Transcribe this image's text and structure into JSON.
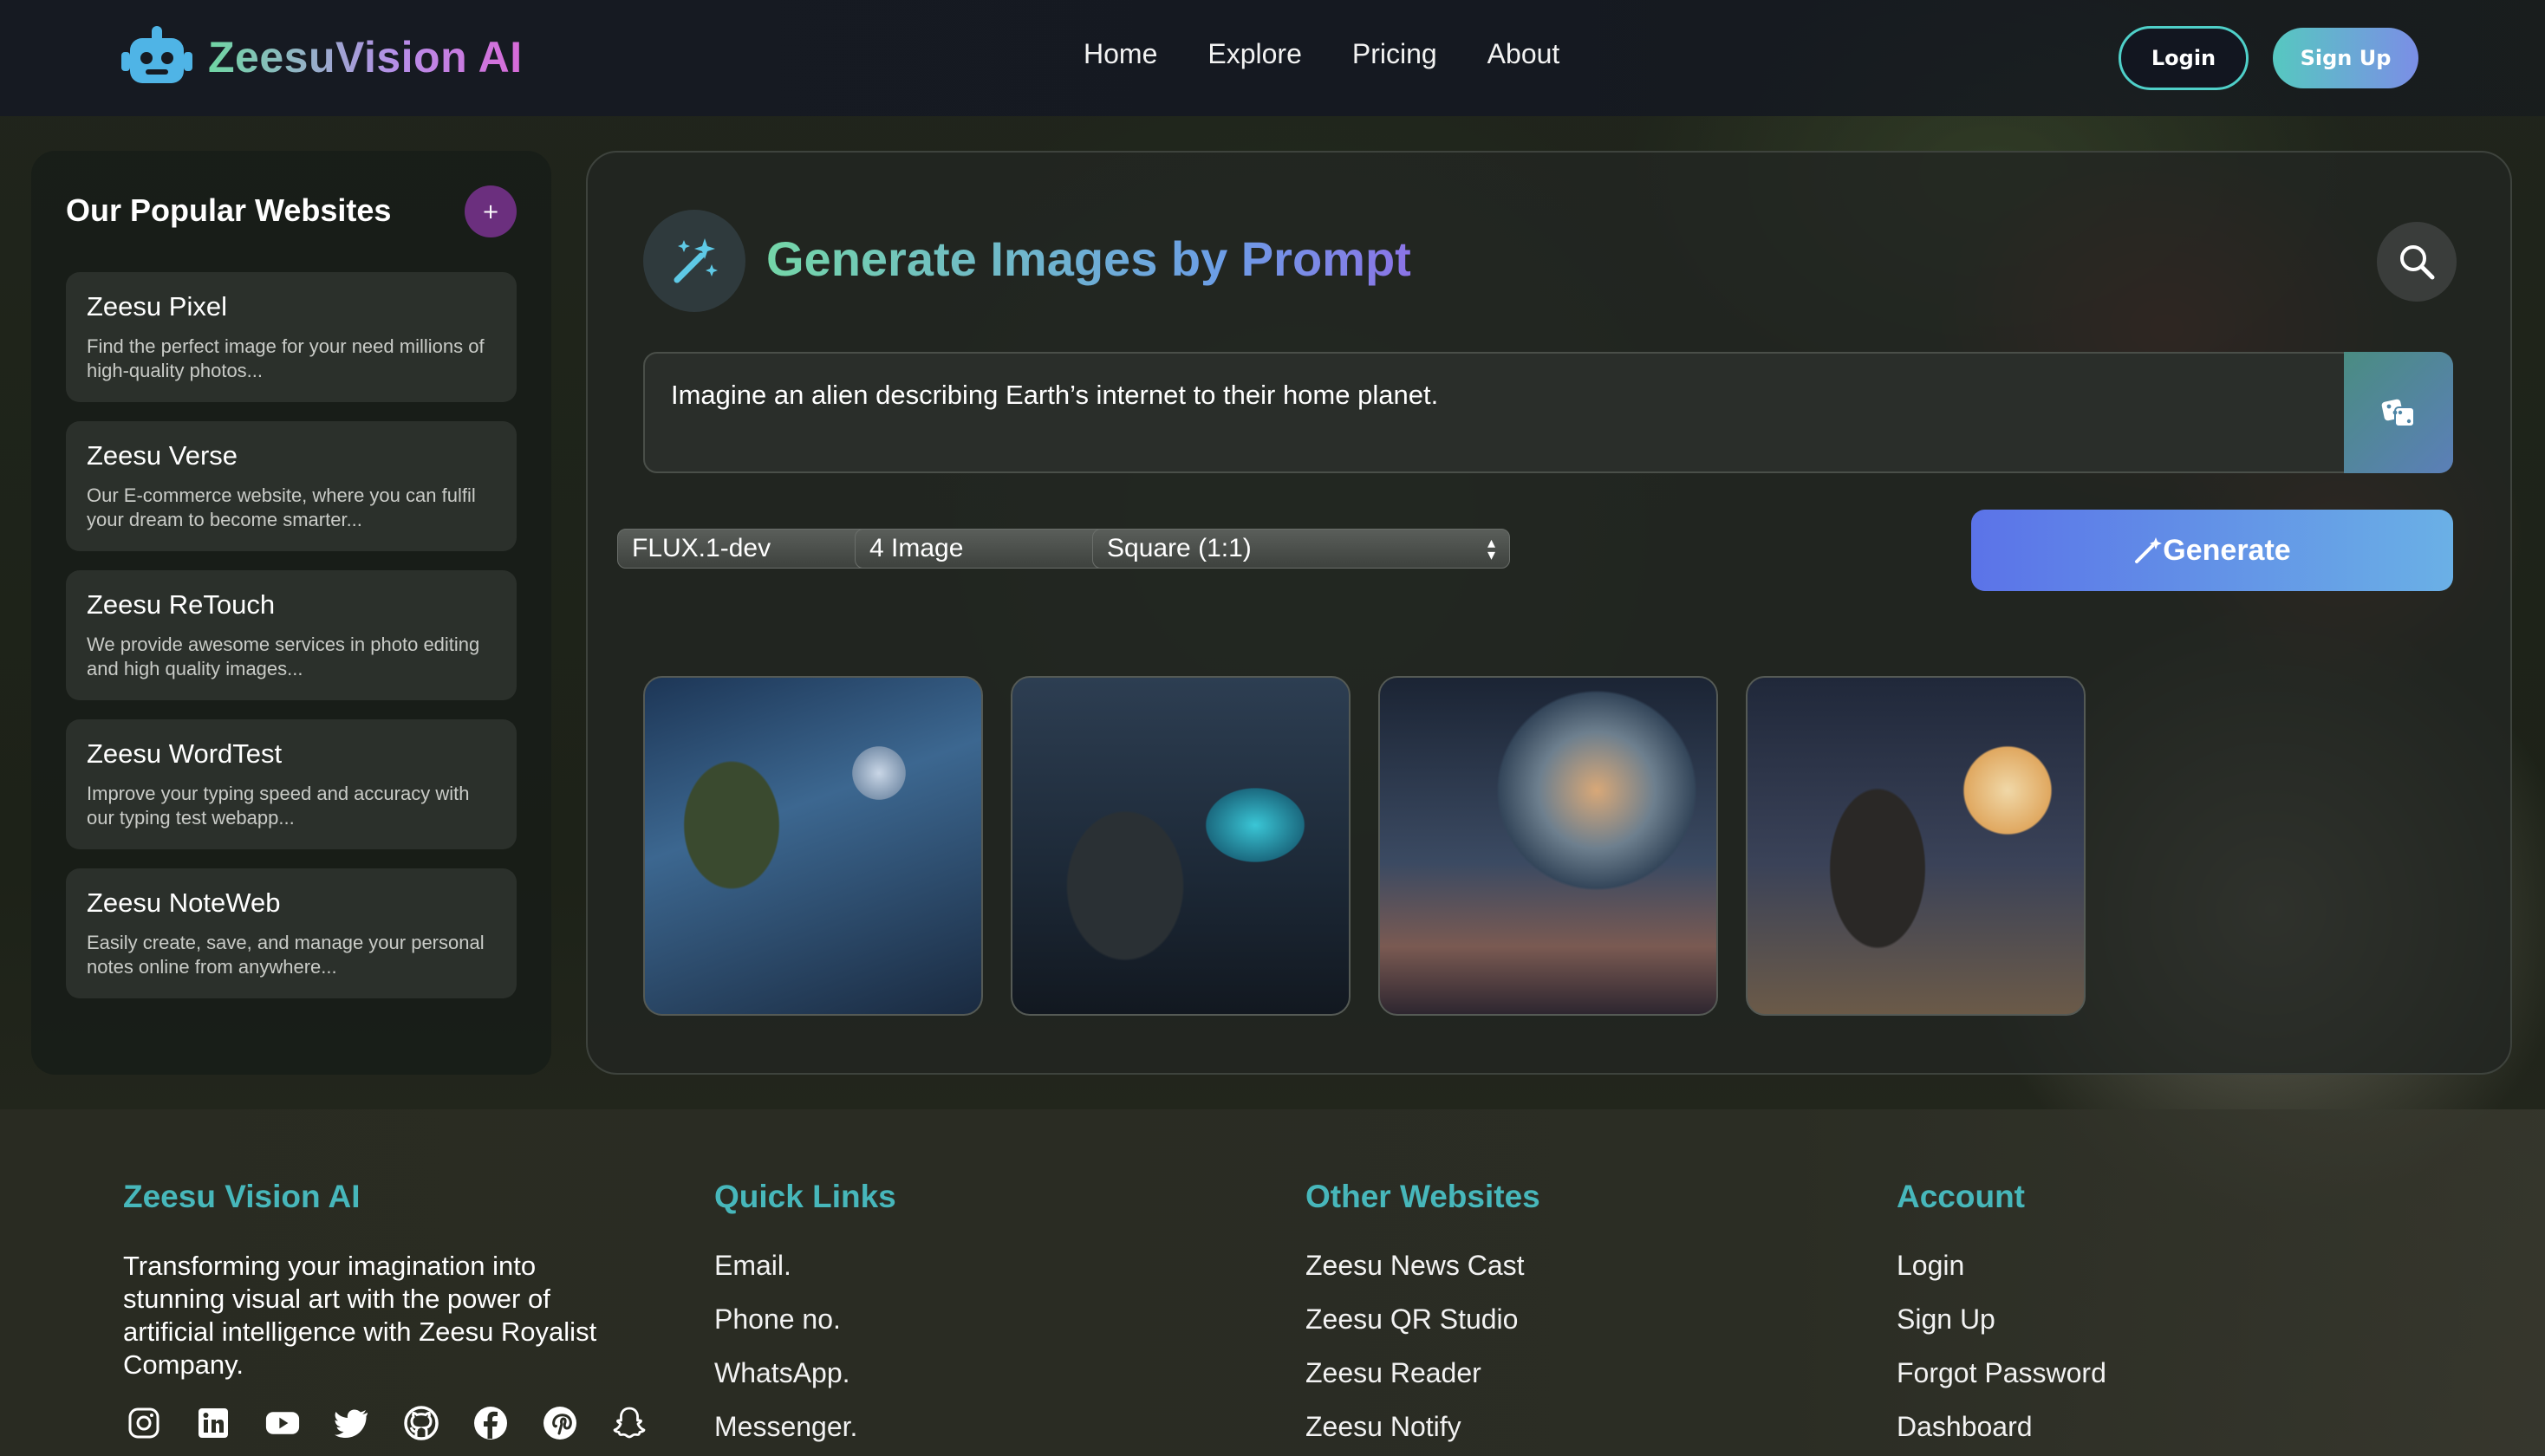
{
  "brand": {
    "name": "ZeesuVision AI"
  },
  "nav": {
    "links": [
      "Home",
      "Explore",
      "Pricing",
      "About"
    ],
    "login_label": "Login",
    "signup_label": "Sign Up"
  },
  "sidebar": {
    "title": "Our Popular Websites",
    "add_label": "+",
    "items": [
      {
        "title": "Zeesu Pixel",
        "desc": "Find the perfect image for your need millions of high-quality photos..."
      },
      {
        "title": "Zeesu Verse",
        "desc": "Our E-commerce website, where you can fulfil your dream to become smarter..."
      },
      {
        "title": "Zeesu ReTouch",
        "desc": "We provide awesome services in photo editing and high quality images..."
      },
      {
        "title": "Zeesu WordTest",
        "desc": "Improve your typing speed and accuracy with our typing test webapp..."
      },
      {
        "title": "Zeesu NoteWeb",
        "desc": "Easily create, save, and manage your personal notes online from anywhere..."
      }
    ]
  },
  "main": {
    "title": "Generate Images by Prompt",
    "prompt_value": "Imagine an alien describing Earth’s internet to their home planet.",
    "model_select": "FLUX.1-dev",
    "count_select": "4 Image",
    "ratio_select": "Square (1:1)",
    "generate_label": "Generate",
    "icons": {
      "title": "magic-wand-icon",
      "search": "search-icon",
      "random": "dice-icon"
    }
  },
  "footer": {
    "about": {
      "heading": "Zeesu Vision AI",
      "text": "Transforming your imagination into stunning visual art with the power of artificial intelligence with Zeesu Royalist Company."
    },
    "quick_links": {
      "heading": "Quick Links",
      "items": [
        "Email.",
        "Phone no.",
        "WhatsApp.",
        "Messenger."
      ]
    },
    "other_websites": {
      "heading": "Other Websites",
      "items": [
        "Zeesu News Cast",
        "Zeesu QR Studio",
        "Zeesu Reader",
        "Zeesu Notify"
      ]
    },
    "account": {
      "heading": "Account",
      "items": [
        "Login",
        "Sign Up",
        "Forgot Password",
        "Dashboard"
      ]
    },
    "socials": [
      "instagram-icon",
      "linkedin-icon",
      "youtube-icon",
      "twitter-icon",
      "github-icon",
      "facebook-icon",
      "pinterest-icon",
      "snapchat-icon"
    ]
  }
}
